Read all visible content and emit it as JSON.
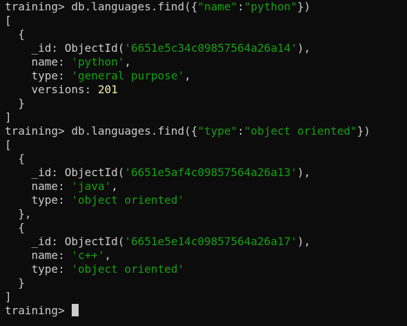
{
  "terminal": {
    "colors": {
      "background": "#0c0c0c",
      "text": "#cccccc",
      "string": "#13a10e",
      "number": "#f9f1a5"
    },
    "lines": [
      [
        {
          "t": "training> db.languages.find({"
        },
        {
          "t": "\"name\"",
          "c": "str"
        },
        {
          "t": ":"
        },
        {
          "t": "\"python\"",
          "c": "str"
        },
        {
          "t": "})"
        }
      ],
      [
        {
          "t": "["
        }
      ],
      [
        {
          "t": "  {"
        }
      ],
      [
        {
          "t": "    _id: ObjectId("
        },
        {
          "t": "'6651e5c34c09857564a26a14'",
          "c": "str"
        },
        {
          "t": "),"
        }
      ],
      [
        {
          "t": "    name: "
        },
        {
          "t": "'python'",
          "c": "str"
        },
        {
          "t": ","
        }
      ],
      [
        {
          "t": "    type: "
        },
        {
          "t": "'general purpose'",
          "c": "str"
        },
        {
          "t": ","
        }
      ],
      [
        {
          "t": "    versions: "
        },
        {
          "t": "201",
          "c": "num"
        }
      ],
      [
        {
          "t": "  }"
        }
      ],
      [
        {
          "t": "]"
        }
      ],
      [
        {
          "t": "training> db.languages.find({"
        },
        {
          "t": "\"type\"",
          "c": "str"
        },
        {
          "t": ":"
        },
        {
          "t": "\"object oriented\"",
          "c": "str"
        },
        {
          "t": "})"
        }
      ],
      [
        {
          "t": "["
        }
      ],
      [
        {
          "t": "  {"
        }
      ],
      [
        {
          "t": "    _id: ObjectId("
        },
        {
          "t": "'6651e5af4c09857564a26a13'",
          "c": "str"
        },
        {
          "t": "),"
        }
      ],
      [
        {
          "t": "    name: "
        },
        {
          "t": "'java'",
          "c": "str"
        },
        {
          "t": ","
        }
      ],
      [
        {
          "t": "    type: "
        },
        {
          "t": "'object oriented'",
          "c": "str"
        }
      ],
      [
        {
          "t": "  },"
        }
      ],
      [
        {
          "t": "  {"
        }
      ],
      [
        {
          "t": "    _id: ObjectId("
        },
        {
          "t": "'6651e5e14c09857564a26a17'",
          "c": "str"
        },
        {
          "t": "),"
        }
      ],
      [
        {
          "t": "    name: "
        },
        {
          "t": "'c++'",
          "c": "str"
        },
        {
          "t": ","
        }
      ],
      [
        {
          "t": "    type: "
        },
        {
          "t": "'object oriented'",
          "c": "str"
        }
      ],
      [
        {
          "t": "  }"
        }
      ],
      [
        {
          "t": "]"
        }
      ]
    ],
    "prompt": "training> "
  }
}
